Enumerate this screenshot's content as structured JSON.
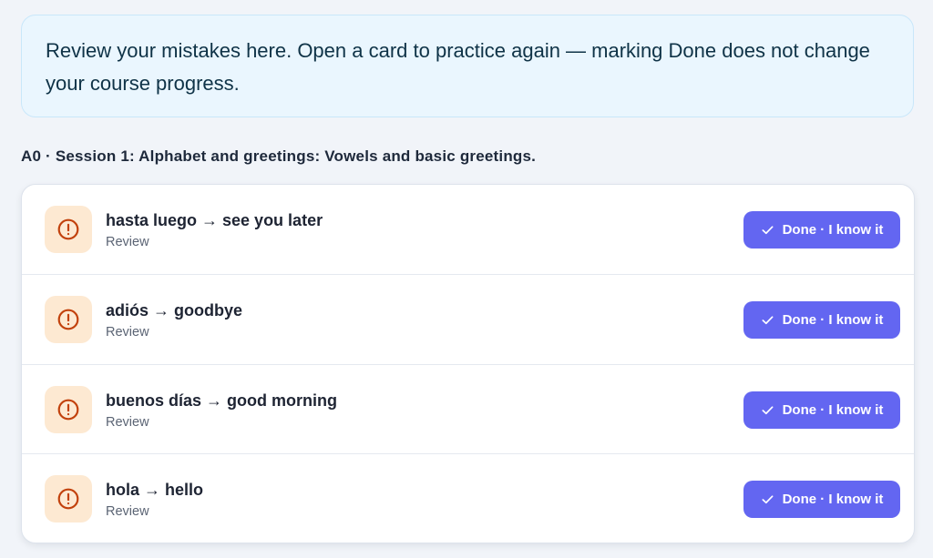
{
  "notice": {
    "text": "Review your mistakes here. Open a card to practice again — marking Done does not change your course progress."
  },
  "section": {
    "heading": "A0 · Session 1: Alphabet and greetings: Vowels and basic greetings."
  },
  "cards": [
    {
      "term": "hasta luego → see you later",
      "status": "Review",
      "button_label": "Done · I know it",
      "icon": "alert-circle-icon"
    },
    {
      "term": "adiós → goodbye",
      "status": "Review",
      "button_label": "Done · I know it",
      "icon": "alert-circle-icon"
    },
    {
      "term": "buenos días → good morning",
      "status": "Review",
      "button_label": "Done · I know it",
      "icon": "alert-circle-icon"
    },
    {
      "term": "hola → hello",
      "status": "Review",
      "button_label": "Done · I know it",
      "icon": "alert-circle-icon"
    }
  ],
  "colors": {
    "accent": "#6366f1",
    "warning_icon": "#c2410c",
    "warning_badge_bg": "#fde9d2",
    "notice_bg": "#eaf6fe"
  }
}
